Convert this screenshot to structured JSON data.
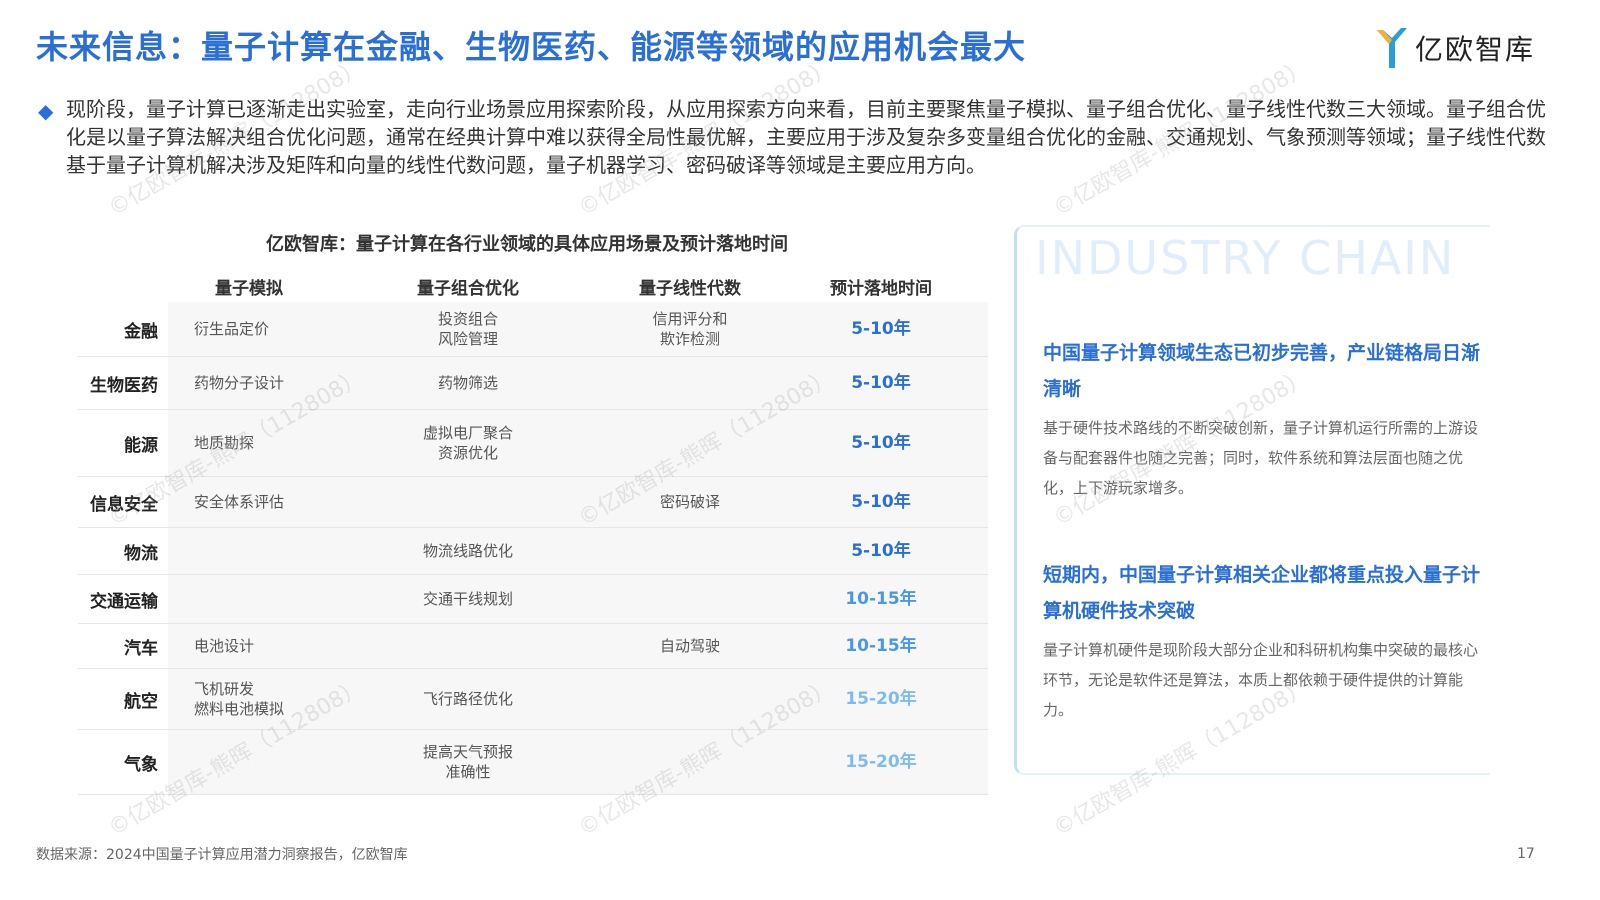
{
  "title": "未来信息：量子计算在金融、生物医药、能源等领域的应用机会最大",
  "logo": {
    "text": "亿欧智库"
  },
  "intro": {
    "text": "现阶段，量子计算已逐渐走出实验室，走向行业场景应用探索阶段，从应用探索方向来看，目前主要聚焦量子模拟、量子组合优化、量子线性代数三大领域。量子组合优化是以量子算法解决组合优化问题，通常在经典计算中难以获得全局性最优解，主要应用于涉及复杂多变量组合优化的金融、交通规划、气象预测等领域；量子线性代数基于量子计算机解决涉及矩阵和向量的线性代数问题，量子机器学习、密码破译等领域是主要应用方向。"
  },
  "table": {
    "title": "亿欧智库：量子计算在各行业领域的具体应用场景及预计落地时间",
    "headers": [
      "",
      "量子模拟",
      "量子组合优化",
      "量子线性代数",
      "预计落地时间"
    ],
    "rows": [
      {
        "industry": "金融",
        "sim": "衍生品定价",
        "opt": "投资组合\n风险管理",
        "lin": "信用评分和\n欺诈检测",
        "time": "5-10年",
        "color": "#2a6fd6"
      },
      {
        "industry": "生物医药",
        "sim": "药物分子设计",
        "opt": "药物筛选",
        "lin": "",
        "time": "5-10年",
        "color": "#2a6fd6"
      },
      {
        "industry": "能源",
        "sim": "地质勘探",
        "opt": "虚拟电厂聚合\n资源优化",
        "lin": "",
        "time": "5-10年",
        "color": "#2a6fd6"
      },
      {
        "industry": "信息安全",
        "sim": "安全体系评估",
        "opt": "",
        "lin": "密码破译",
        "time": "5-10年",
        "color": "#2a6fd6"
      },
      {
        "industry": "物流",
        "sim": "",
        "opt": "物流线路优化",
        "lin": "",
        "time": "5-10年",
        "color": "#2a6fd6"
      },
      {
        "industry": "交通运输",
        "sim": "",
        "opt": "交通干线规划",
        "lin": "",
        "time": "10-15年",
        "color": "#4a97e8"
      },
      {
        "industry": "汽车",
        "sim": "电池设计",
        "opt": "",
        "lin": "自动驾驶",
        "time": "10-15年",
        "color": "#4a97e8"
      },
      {
        "industry": "航空",
        "sim": "飞机研发\n燃料电池模拟",
        "opt": "飞行路径优化",
        "lin": "",
        "time": "15-20年",
        "color": "#7cbcf2"
      },
      {
        "industry": "气象",
        "sim": "",
        "opt": "提高天气预报\n准确性",
        "lin": "",
        "time": "15-20年",
        "color": "#7cbcf2"
      }
    ]
  },
  "panel": {
    "bg_text": "INDUSTRY CHAIN",
    "head1": "中国量子计算领域生态已初步完善，产业链格局日渐清晰",
    "body1": "基于硬件技术路线的不断突破创新，量子计算机运行所需的上游设备与配套器件也随之完善；同时，软件系统和算法层面也随之优化，上下游玩家增多。",
    "head2": "短期内，中国量子计算相关企业都将重点投入量子计算机硬件技术突破",
    "body2": "量子计算机硬件是现阶段大部分企业和科研机构集中突破的最核心环节，无论是软件还是算法，本质上都依赖于硬件提供的计算能力。"
  },
  "watermark": "©亿欧智库-熊晖（112808）",
  "source": "数据来源：2024中国量子计算应用潜力洞察报告，亿欧智库",
  "page_number": "17"
}
